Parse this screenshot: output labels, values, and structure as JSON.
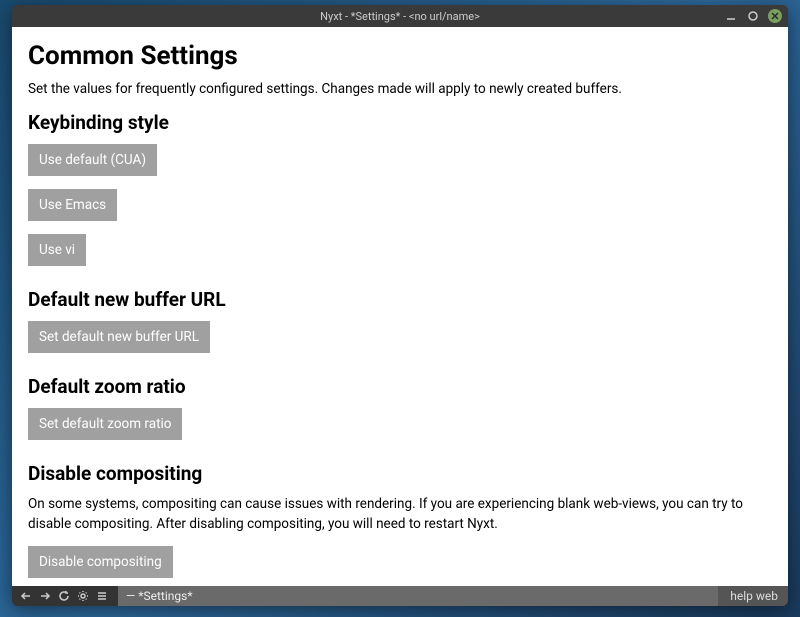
{
  "window": {
    "title": "Nyxt - *Settings* - <no url/name>"
  },
  "page": {
    "heading": "Common Settings",
    "description": "Set the values for frequently configured settings. Changes made will apply to newly created buffers."
  },
  "sections": {
    "keybinding": {
      "title": "Keybinding style",
      "buttons": {
        "cua": "Use default (CUA)",
        "emacs": "Use Emacs",
        "vi": "Use vi"
      }
    },
    "new_buffer_url": {
      "title": "Default new buffer URL",
      "button": "Set default new buffer URL"
    },
    "zoom_ratio": {
      "title": "Default zoom ratio",
      "button": "Set default zoom ratio"
    },
    "compositing": {
      "title": "Disable compositing",
      "text": "On some systems, compositing can cause issues with rendering. If you are experiencing blank web-views, you can try to disable compositing. After disabling compositing, you will need to restart Nyxt.",
      "button": "Disable compositing"
    }
  },
  "statusbar": {
    "buffer": "— *Settings*",
    "modes": "help web"
  }
}
